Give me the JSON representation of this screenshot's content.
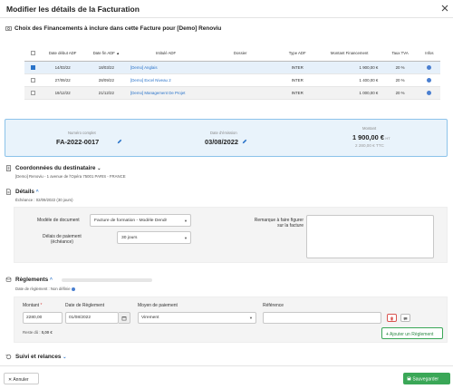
{
  "header": {
    "title": "Modifier les détails de la Facturation",
    "close_icon": "close-icon"
  },
  "financements": {
    "title": "Choix des Financements à inclure dans cette Facture pour [Demo] Renoviu",
    "columns": [
      "Date début ADF",
      "Date fin ADF",
      "Intitulé ADF",
      "Dossier",
      "Type ADF",
      "Montant Financement",
      "Taux TVA",
      "Infos"
    ],
    "rows": [
      {
        "checked": true,
        "start": "14/03/22",
        "end": "18/03/22",
        "title": "[Demo] Anglais",
        "dossier": "",
        "type": "INTER",
        "amount": "1 900,00 €",
        "tva": "20 %"
      },
      {
        "checked": false,
        "start": "27/09/22",
        "end": "28/09/22",
        "title": "[Demo] Excel Niveau 2",
        "dossier": "",
        "type": "INTER",
        "amount": "1 400,00 €",
        "tva": "20 %"
      },
      {
        "checked": false,
        "start": "19/12/22",
        "end": "21/12/22",
        "title": "[Demo] Management De Projet",
        "dossier": "",
        "type": "INTER",
        "amount": "1 000,00 €",
        "tva": "20 %"
      }
    ]
  },
  "invoice": {
    "number_label": "Numéro complet",
    "number": "FA-2022-0017",
    "date_label": "Date d'émission",
    "date": "03/08/2022",
    "amount_label": "Montant",
    "amount_ht": "1 900,00 €",
    "ht": "HT",
    "amount_ttc": "2 280,00 € TTC"
  },
  "recipient": {
    "title": "Coordonnées du destinataire",
    "address": "[Demo] Renoviu - 1 avenue de l'Opéra 75001 PARIS - FRANCE"
  },
  "details": {
    "title": "Détails",
    "echeance": "Échéance : 02/09/2022 (30 jours)",
    "model_label": "Modèle de document",
    "model_value": "Facture de formation - Modèle Dendr",
    "delay_label_1": "Délais de paiement",
    "delay_label_2": "(échéance)",
    "delay_value": "30 jours",
    "remark_label_1": "Remarque à faire figurer",
    "remark_label_2": "sur la facture"
  },
  "reglements": {
    "title": "Règlements",
    "date_reglement": "Date de règlement : Non définie",
    "col_montant": "Montant",
    "col_date": "Date de Règlement",
    "col_moyen": "Moyen de paiement",
    "col_ref": "Référence",
    "montant": "2280,00",
    "date": "01/08/2022",
    "moyen": "Virement",
    "reference": "",
    "reste": "Reste dû : ",
    "reste_value": "0,00 €",
    "add_label": "Ajouter un Règlement"
  },
  "suivi": {
    "title": "Suivi et relances"
  },
  "footer": {
    "cancel": "Annuler",
    "save": "Sauvegarder"
  },
  "colors": {
    "accent": "#2a73c9",
    "success": "#3aa757",
    "danger": "#d9534f",
    "panel": "#e9f3fb"
  }
}
